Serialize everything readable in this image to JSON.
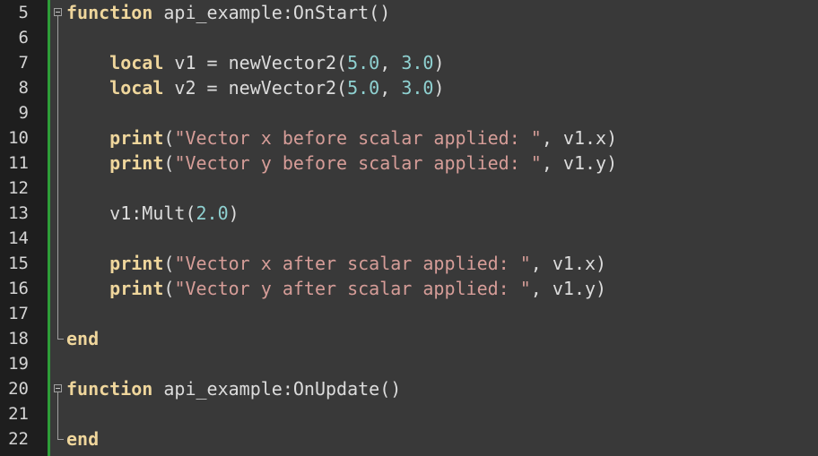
{
  "editor": {
    "lines": [
      {
        "num": "5",
        "parts": [
          {
            "t": "kw",
            "v": "function"
          },
          {
            "t": "pl",
            "v": " api_example:OnStart()"
          }
        ]
      },
      {
        "num": "6",
        "parts": []
      },
      {
        "num": "7",
        "parts": [
          {
            "t": "pl",
            "v": "    "
          },
          {
            "t": "kw",
            "v": "local"
          },
          {
            "t": "pl",
            "v": " v1 = newVector2("
          },
          {
            "t": "num",
            "v": "5.0"
          },
          {
            "t": "pl",
            "v": ", "
          },
          {
            "t": "num",
            "v": "3.0"
          },
          {
            "t": "pl",
            "v": ")"
          }
        ]
      },
      {
        "num": "8",
        "parts": [
          {
            "t": "pl",
            "v": "    "
          },
          {
            "t": "kw",
            "v": "local"
          },
          {
            "t": "pl",
            "v": " v2 = newVector2("
          },
          {
            "t": "num",
            "v": "5.0"
          },
          {
            "t": "pl",
            "v": ", "
          },
          {
            "t": "num",
            "v": "3.0"
          },
          {
            "t": "pl",
            "v": ")"
          }
        ]
      },
      {
        "num": "9",
        "parts": []
      },
      {
        "num": "10",
        "parts": [
          {
            "t": "pl",
            "v": "    "
          },
          {
            "t": "kw",
            "v": "print"
          },
          {
            "t": "pl",
            "v": "("
          },
          {
            "t": "str",
            "v": "\"Vector x before scalar applied: \""
          },
          {
            "t": "pl",
            "v": ", v1.x)"
          }
        ]
      },
      {
        "num": "11",
        "parts": [
          {
            "t": "pl",
            "v": "    "
          },
          {
            "t": "kw",
            "v": "print"
          },
          {
            "t": "pl",
            "v": "("
          },
          {
            "t": "str",
            "v": "\"Vector y before scalar applied: \""
          },
          {
            "t": "pl",
            "v": ", v1.y)"
          }
        ]
      },
      {
        "num": "12",
        "parts": []
      },
      {
        "num": "13",
        "parts": [
          {
            "t": "pl",
            "v": "    v1:Mult("
          },
          {
            "t": "num",
            "v": "2.0"
          },
          {
            "t": "pl",
            "v": ")"
          }
        ]
      },
      {
        "num": "14",
        "parts": []
      },
      {
        "num": "15",
        "parts": [
          {
            "t": "pl",
            "v": "    "
          },
          {
            "t": "kw",
            "v": "print"
          },
          {
            "t": "pl",
            "v": "("
          },
          {
            "t": "str",
            "v": "\"Vector x after scalar applied: \""
          },
          {
            "t": "pl",
            "v": ", v1.x)"
          }
        ]
      },
      {
        "num": "16",
        "parts": [
          {
            "t": "pl",
            "v": "    "
          },
          {
            "t": "kw",
            "v": "print"
          },
          {
            "t": "pl",
            "v": "("
          },
          {
            "t": "str",
            "v": "\"Vector y after scalar applied: \""
          },
          {
            "t": "pl",
            "v": ", v1.y)"
          }
        ]
      },
      {
        "num": "17",
        "parts": []
      },
      {
        "num": "18",
        "parts": [
          {
            "t": "kw",
            "v": "end"
          }
        ]
      },
      {
        "num": "19",
        "parts": []
      },
      {
        "num": "20",
        "parts": [
          {
            "t": "kw",
            "v": "function"
          },
          {
            "t": "pl",
            "v": " api_example:OnUpdate()"
          }
        ]
      },
      {
        "num": "21",
        "parts": []
      },
      {
        "num": "22",
        "parts": [
          {
            "t": "kw",
            "v": "end"
          }
        ]
      }
    ]
  },
  "colors": {
    "background": "#393939",
    "gutter": "#1e1e1e",
    "change_bar": "#2e9e38",
    "keyword": "#efd69c",
    "number": "#8fd1d1",
    "string": "#d69d98",
    "plain": "#dcdcdc"
  },
  "icons": {
    "fold_toggle": "fold-minus-icon"
  }
}
